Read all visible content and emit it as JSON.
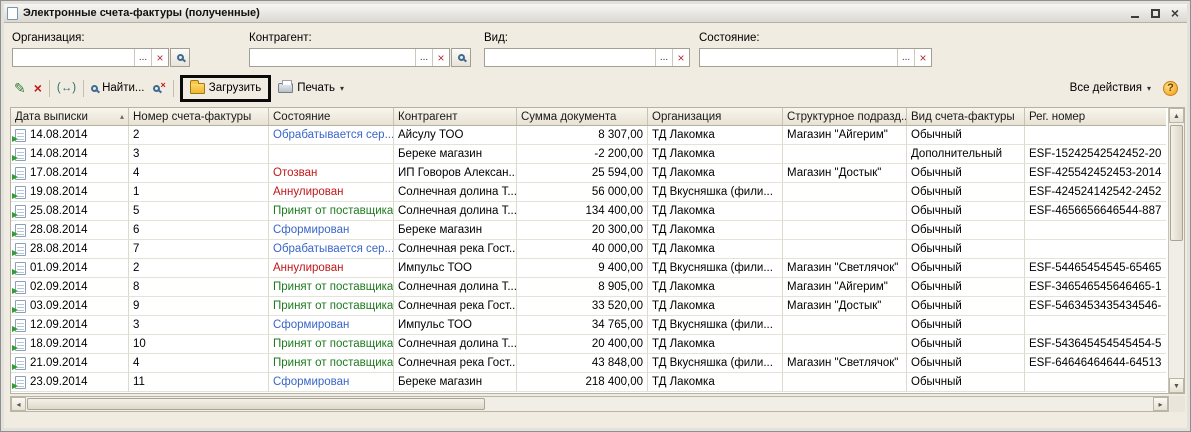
{
  "window": {
    "title": "Электронные счета-фактуры (полученные)"
  },
  "filters": {
    "choose_label": "...",
    "clear_label": "×",
    "items": [
      {
        "label": "Организация:",
        "value": "",
        "has_search": true
      },
      {
        "label": "Контрагент:",
        "value": "",
        "has_search": true
      },
      {
        "label": "Вид:",
        "value": "",
        "has_search": false
      },
      {
        "label": "Состояние:",
        "value": "",
        "has_search": false
      }
    ]
  },
  "toolbar": {
    "find_label": "Найти...",
    "load_label": "Загрузить",
    "print_label": "Печать",
    "all_actions_label": "Все действия",
    "help_label": "?"
  },
  "icons": {
    "pencil": "✎",
    "delete_x": "×",
    "date_interval": "(↔)",
    "caret_down": "▾",
    "scroll_up": "▲",
    "scroll_down": "▼",
    "scroll_left": "◂",
    "scroll_right": "▸",
    "sort_asc": "▴",
    "close": "×"
  },
  "colors": {
    "blue": "#3a66c8",
    "green": "#1d7a1d",
    "red": "#c01818"
  },
  "table": {
    "sorted_column": 0,
    "columns": [
      "Дата выписки",
      "Номер счета-фактуры",
      "Состояние",
      "Контрагент",
      "Сумма документа",
      "Организация",
      "Структурное подразд...",
      "Вид счета-фактуры",
      "Рег. номер"
    ],
    "rows": [
      {
        "date": "14.08.2014",
        "number": "2",
        "state": "Обрабатывается сер...",
        "state_color": "blue",
        "counterparty": "Айсулу ТОО",
        "amount": "8 307,00",
        "organization": "ТД Лакомка",
        "subdivision": "Магазин \"Айгерим\"",
        "kind": "Обычный",
        "reg_number": ""
      },
      {
        "date": "14.08.2014",
        "number": "3",
        "state": "",
        "state_color": "",
        "counterparty": "Береке магазин",
        "amount": "-2 200,00",
        "organization": "ТД Лакомка",
        "subdivision": "",
        "kind": "Дополнительный",
        "reg_number": "ESF-15242542542452-20"
      },
      {
        "date": "17.08.2014",
        "number": "4",
        "state": "Отозван",
        "state_color": "red",
        "counterparty": "ИП Говоров Алексан...",
        "amount": "25 594,00",
        "organization": "ТД Лакомка",
        "subdivision": "Магазин \"Достык\"",
        "kind": "Обычный",
        "reg_number": "ESF-425542452453-2014"
      },
      {
        "date": "19.08.2014",
        "number": "1",
        "state": "Аннулирован",
        "state_color": "red",
        "counterparty": "Солнечная долина Т...",
        "amount": "56 000,00",
        "organization": "ТД Вкусняшка (фили...",
        "subdivision": "",
        "kind": "Обычный",
        "reg_number": "ESF-424524142542-2452"
      },
      {
        "date": "25.08.2014",
        "number": "5",
        "state": "Принят от поставщика",
        "state_color": "green",
        "counterparty": "Солнечная долина Т...",
        "amount": "134 400,00",
        "organization": "ТД Лакомка",
        "subdivision": "",
        "kind": "Обычный",
        "reg_number": "ESF-4656656646544-887"
      },
      {
        "date": "28.08.2014",
        "number": "6",
        "state": "Сформирован",
        "state_color": "blue",
        "counterparty": "Береке магазин",
        "amount": "20 300,00",
        "organization": "ТД Лакомка",
        "subdivision": "",
        "kind": "Обычный",
        "reg_number": ""
      },
      {
        "date": "28.08.2014",
        "number": "7",
        "state": "Обрабатывается сер...",
        "state_color": "blue",
        "counterparty": "Солнечная река Гост...",
        "amount": "40 000,00",
        "organization": "ТД Лакомка",
        "subdivision": "",
        "kind": "Обычный",
        "reg_number": ""
      },
      {
        "date": "01.09.2014",
        "number": "2",
        "state": "Аннулирован",
        "state_color": "red",
        "counterparty": "Импульс ТОО",
        "amount": "9 400,00",
        "organization": "ТД Вкусняшка (фили...",
        "subdivision": "Магазин \"Светлячок\"",
        "kind": "Обычный",
        "reg_number": "ESF-54465454545-65465"
      },
      {
        "date": "02.09.2014",
        "number": "8",
        "state": "Принят от поставщика",
        "state_color": "green",
        "counterparty": "Солнечная долина Т...",
        "amount": "8 905,00",
        "organization": "ТД Лакомка",
        "subdivision": "Магазин \"Айгерим\"",
        "kind": "Обычный",
        "reg_number": "ESF-346546545646465-1"
      },
      {
        "date": "03.09.2014",
        "number": "9",
        "state": "Принят от поставщика",
        "state_color": "green",
        "counterparty": "Солнечная река Гост...",
        "amount": "33 520,00",
        "organization": "ТД Лакомка",
        "subdivision": "Магазин \"Достык\"",
        "kind": "Обычный",
        "reg_number": "ESF-5463453435434546-"
      },
      {
        "date": "12.09.2014",
        "number": "3",
        "state": "Сформирован",
        "state_color": "blue",
        "counterparty": "Импульс ТОО",
        "amount": "34 765,00",
        "organization": "ТД Вкусняшка (фили...",
        "subdivision": "",
        "kind": "Обычный",
        "reg_number": ""
      },
      {
        "date": "18.09.2014",
        "number": "10",
        "state": "Принят от поставщика",
        "state_color": "green",
        "counterparty": "Солнечная долина Т...",
        "amount": "20 400,00",
        "organization": "ТД Лакомка",
        "subdivision": "",
        "kind": "Обычный",
        "reg_number": "ESF-543645454545454-5"
      },
      {
        "date": "21.09.2014",
        "number": "4",
        "state": "Принят от поставщика",
        "state_color": "green",
        "counterparty": "Солнечная река Гост...",
        "amount": "43 848,00",
        "organization": "ТД Вкусняшка (фили...",
        "subdivision": "Магазин \"Светлячок\"",
        "kind": "Обычный",
        "reg_number": "ESF-64646464644-64513"
      },
      {
        "date": "23.09.2014",
        "number": "11",
        "state": "Сформирован",
        "state_color": "blue",
        "counterparty": "Береке магазин",
        "amount": "218 400,00",
        "organization": "ТД Лакомка",
        "subdivision": "",
        "kind": "Обычный",
        "reg_number": ""
      }
    ]
  }
}
